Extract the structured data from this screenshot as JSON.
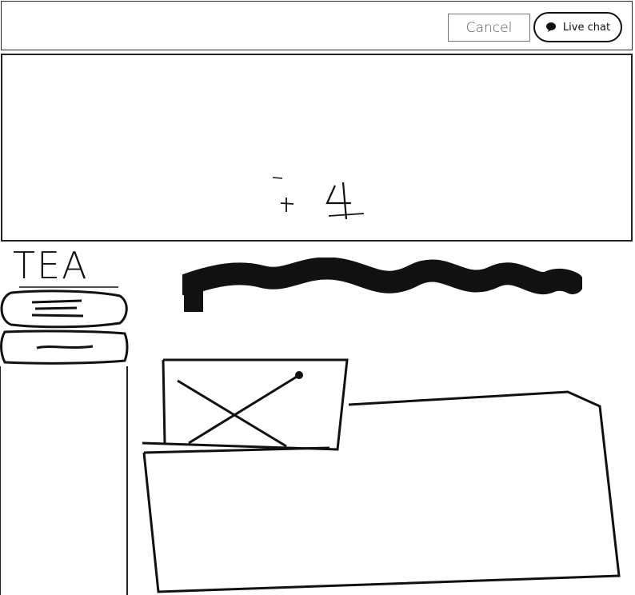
{
  "header": {
    "cancel_label": "Cancel",
    "livechat_label": "Live chat",
    "livechat_icon": "chat-bubble-icon"
  },
  "hero": {
    "doodle_text": "+ 4"
  },
  "sidebar": {
    "title": "TEA"
  },
  "colors": {
    "ink": "#111111",
    "border": "#222222",
    "muted_border": "#777777",
    "background": "#ffffff"
  }
}
